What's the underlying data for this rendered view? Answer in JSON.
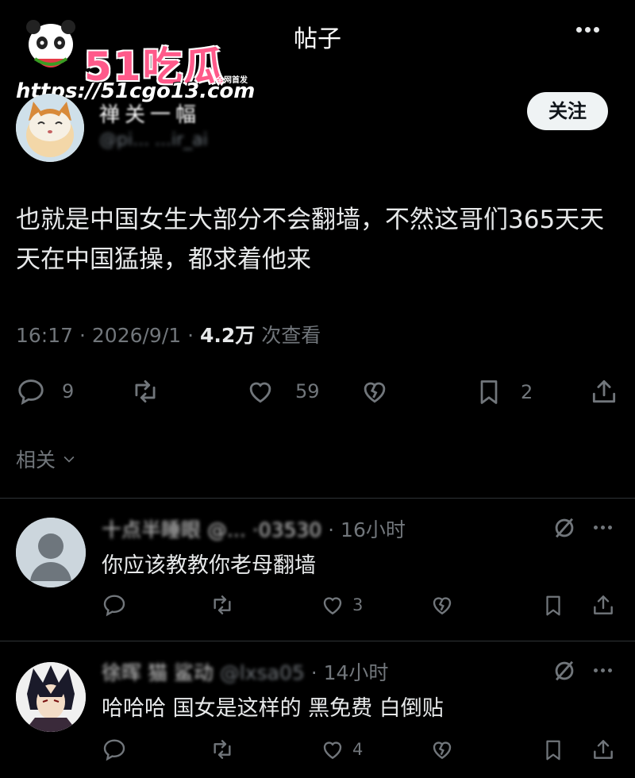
{
  "header": {
    "title": "帖子",
    "more_icon": "more-horizontal-icon"
  },
  "watermark": {
    "logo_text": "51吃瓜",
    "logo_sub": "全网首发",
    "url": "https://51cgo13.com"
  },
  "post": {
    "author_name": "禅关一幅",
    "author_handle": "@pi... ...ir_ai",
    "follow_label": "关注",
    "text": "也就是中国女生大部分不会翻墙，不然这哥们365天天天在中国猛操，都求着他来",
    "time": "16:17 · 2026/9/1 · ",
    "views": "4.2万",
    "views_suffix": " 次查看",
    "replies": "9",
    "likes": "59",
    "bookmarks": "2",
    "related_label": "相关"
  },
  "replies": [
    {
      "name": "十点半睡眼 @... ·03530",
      "time": " · 16小时",
      "text": "你应该教教你老母翻墙",
      "replies": "",
      "likes": "3"
    },
    {
      "name": "徐晖 猫 鲨动",
      "handle": " @lxsa05",
      "time": " · 14小时",
      "text": "哈哈哈 国女是这样的 黑免费 白倒贴",
      "replies": "",
      "likes": "4"
    }
  ],
  "colors": {
    "background": "#000000",
    "text": "#e7e9ea",
    "muted": "#71767b",
    "divider": "#2f3336",
    "follow_bg": "#eff3f4",
    "logo_pink": "#ff5a8a"
  }
}
